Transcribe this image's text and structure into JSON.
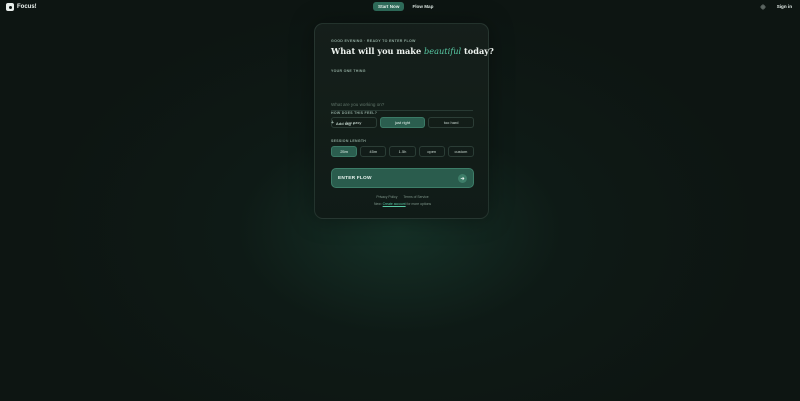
{
  "header": {
    "brand": "Focus!",
    "nav": [
      {
        "label": "Start Now",
        "active": true
      },
      {
        "label": "Flow Map",
        "active": false
      }
    ],
    "theme_icon": "sun-icon",
    "signin_label": "Sign in"
  },
  "card": {
    "kicker": "GOOD EVENING · READY TO ENTER FLOW",
    "heading_before": "What will you make ",
    "heading_accent": "beautiful",
    "heading_after": " today?",
    "one_thing_label": "YOUR ONE THING",
    "one_thing_placeholder": "What are you working on?",
    "add_tag_label": "Add tag",
    "feel_label": "HOW DOES THIS FEEL?",
    "feel_options": [
      {
        "label": "too easy",
        "active": false
      },
      {
        "label": "just right",
        "active": true
      },
      {
        "label": "too hard",
        "active": false
      }
    ],
    "length_label": "SESSION LENGTH",
    "length_options": [
      {
        "label": "25m",
        "active": true
      },
      {
        "label": "45m",
        "active": false
      },
      {
        "label": "1.5h",
        "active": false
      },
      {
        "label": "open",
        "active": false
      },
      {
        "label": "custom",
        "active": false
      }
    ],
    "enter_flow_label": "ENTER FLOW",
    "footer_links": [
      "Privacy Policy",
      "Terms of Service"
    ],
    "footer_new_prefix": "New: ",
    "footer_new_link": "Create account",
    "footer_new_suffix": " for more options"
  },
  "colors": {
    "accent": "#58c9a4",
    "primary_fill": "#2b5e4f",
    "background": "#0d1512"
  }
}
